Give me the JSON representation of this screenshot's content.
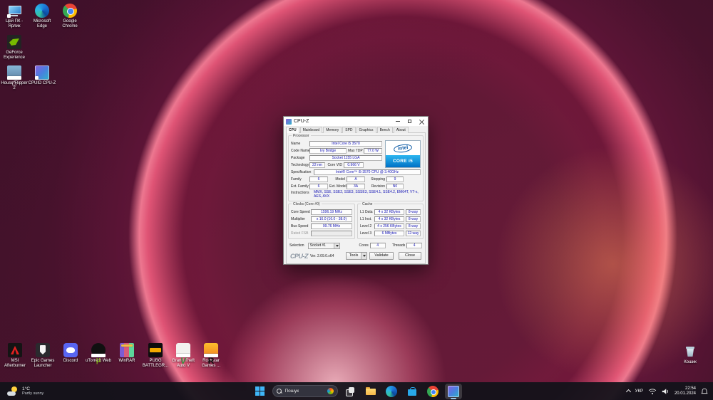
{
  "desktop": {
    "top_icons": [
      {
        "label": "Цей ПК - Ярлик"
      },
      {
        "label": "Microsoft Edge"
      },
      {
        "label": "Google Chrome"
      },
      {
        "label": "GeForce Experience"
      },
      {
        "label": "House Flipper 2"
      },
      {
        "label": "CPUID CPU-Z"
      }
    ],
    "bottom_icons": [
      {
        "label": "MSI Afterburner"
      },
      {
        "label": "Epic Games Launcher"
      },
      {
        "label": "Discord"
      },
      {
        "label": "uTorrent Web"
      },
      {
        "label": "WinRAR"
      },
      {
        "label": "PUBG BATTLEGR..."
      },
      {
        "label": "Grand Theft Auto V"
      },
      {
        "label": "Rockstar Games ..."
      }
    ],
    "recycle_bin_label": "Кошик"
  },
  "cpuz": {
    "title": "CPU-Z",
    "tabs": [
      {
        "label": "CPU"
      },
      {
        "label": "Mainboard"
      },
      {
        "label": "Memory"
      },
      {
        "label": "SPD"
      },
      {
        "label": "Graphics"
      },
      {
        "label": "Bench"
      },
      {
        "label": "About"
      }
    ],
    "processor": {
      "section": "Processor",
      "name_label": "Name",
      "name": "Intel Core i5 3570",
      "code_name_label": "Code Name",
      "code_name": "Ivy Bridge",
      "max_tdp_label": "Max TDP",
      "max_tdp": "77.0 W",
      "package_label": "Package",
      "package": "Socket 1155 LGA",
      "technology_label": "Technology",
      "technology": "22 nm",
      "core_vid_label": "Core VID",
      "core_vid": "0.966 V",
      "specification_label": "Specification",
      "specification": "Intel® Core™ i5-3570 CPU @ 3.40GHz",
      "family_label": "Family",
      "family": "6",
      "model_label": "Model",
      "model": "A",
      "stepping_label": "Stepping",
      "stepping": "9",
      "ext_family_label": "Ext. Family",
      "ext_family": "6",
      "ext_model_label": "Ext. Model",
      "ext_model": "3A",
      "revision_label": "Revision",
      "revision": "N0",
      "instructions_label": "Instructions",
      "instructions": "MMX, SSE, SSE2, SSE3, SSSE3, SSE4.1, SSE4.2, EM64T, VT-x, AES, AVX"
    },
    "badge": {
      "brand": "intel",
      "line": "CORE i5"
    },
    "clocks": {
      "section": "Clocks (Core #0)",
      "core_speed_label": "Core Speed",
      "core_speed": "1596.19 MHz",
      "multiplier_label": "Multiplier",
      "multiplier": "x 16.0 (16.0 - 38.0)",
      "bus_speed_label": "Bus Speed",
      "bus_speed": "99.76 MHz",
      "rated_fsb_label": "Rated FSB",
      "rated_fsb": ""
    },
    "cache": {
      "section": "Cache",
      "rows": [
        {
          "label": "L1 Data",
          "size": "4 x 32 KBytes",
          "assoc": "8-way"
        },
        {
          "label": "L1 Inst.",
          "size": "4 x 32 KBytes",
          "assoc": "8-way"
        },
        {
          "label": "Level 2",
          "size": "4 x 256 KBytes",
          "assoc": "8-way"
        },
        {
          "label": "Level 3",
          "size": "6 MBytes",
          "assoc": "12-way"
        }
      ]
    },
    "footer": {
      "selection_label": "Selection",
      "selection": "Socket #1",
      "cores_label": "Cores",
      "cores": "4",
      "threads_label": "Threads",
      "threads": "4",
      "logo": "CPU-Z",
      "version": "Ver. 2.09.0.x64",
      "tools": "Tools",
      "validate": "Validate",
      "close": "Close"
    }
  },
  "taskbar": {
    "weather": {
      "temp": "1°C",
      "condition": "Partly sunny"
    },
    "search": "Пошук",
    "tray": {
      "language": "УКР",
      "time": "22:54",
      "date": "20.01.2024"
    }
  }
}
